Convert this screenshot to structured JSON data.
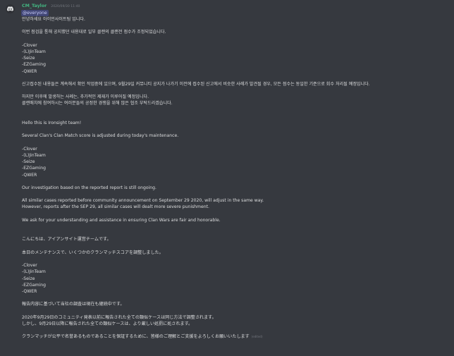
{
  "author": {
    "username": "CM_Taylor",
    "timestamp": "2020/09/30 11:40"
  },
  "mention": "@everyone",
  "korean": {
    "greeting": "안녕하세요 아이언사이트팀 입니다.",
    "intro": "이번 점검을 통해 공지했던 내용대로 일부 클랜의 클랜전 점수가 조정되었습니다.",
    "clans": [
      "-Clover",
      "-(L)JinTeam",
      "-Seize",
      "-EZGaming",
      "-QWER"
    ],
    "investigation": "신고접수된 내용들은 계속해서 확인 작업중에 있으며, 9월29일 커뮤니티 공지가 나가기 이전에 접수된 신고에서 비슷한 사례가 발견될 경우, 모든 점수는 동일한 기준으로 회수 처리될 예정입니다.",
    "after": "하지만 이후에 발생하는 사례는, 추가적인 제재가 이루어질 예정입니다.",
    "closing": "클랜매치에 참여하시는 여러분들의 공정한 경쟁을 위해 많은 협조 부탁드리겠습니다."
  },
  "english": {
    "greeting": "Hello this is Ironsight team!",
    "intro": "Several Clan's Clan Match score is adjusted during today's maintenance.",
    "clans": [
      "-Clover",
      "-(L)JinTeam",
      "-Seize",
      "-EZGaming",
      "-QWER"
    ],
    "investigation": "Our investigation based on the reported report is still ongoing.",
    "similar": "All similar cases reported before community announcement on September 29 2020, will adjust in the same way.",
    "after": "However, reports after the SEP 29, all similar cases will dealt more severe punishment.",
    "closing": "We ask for your understanding and assistance in ensuring Clan Wars are fair and honorable."
  },
  "japanese": {
    "greeting": "こんにちは、アイアンサイト運営チームです。",
    "intro": "本日のメンテナンスで、いくつかのクランマッチスコアを調整しました。",
    "clans": [
      "-Clover",
      "-(L)JinTeam",
      "-Seize",
      "-EZGaming",
      "-QWER"
    ],
    "investigation": "報告内容に基づいて当社の調査は現在も継続中です。",
    "similar": "2020年9月29日のコミュニティ発表以前に報告された全ての類似ケースは同じ方法で調整されます。",
    "after": "しかし、9月29日以降に報告された全ての類似ケースは、より厳しい処罰に処されます。",
    "closing": "クランマッチが公平で名誉あるものであることを保証するために、皆様のご理解とご支援をよろしくお願いいたします",
    "edited": "(edited)"
  },
  "colors": {
    "background": "#36393f",
    "text": "#dcddde",
    "username": "#43b581",
    "mention_bg": "#414675",
    "mention_text": "#c9cdfb",
    "muted": "#72767d"
  },
  "icons": {
    "avatar": "discord-logo-icon"
  }
}
